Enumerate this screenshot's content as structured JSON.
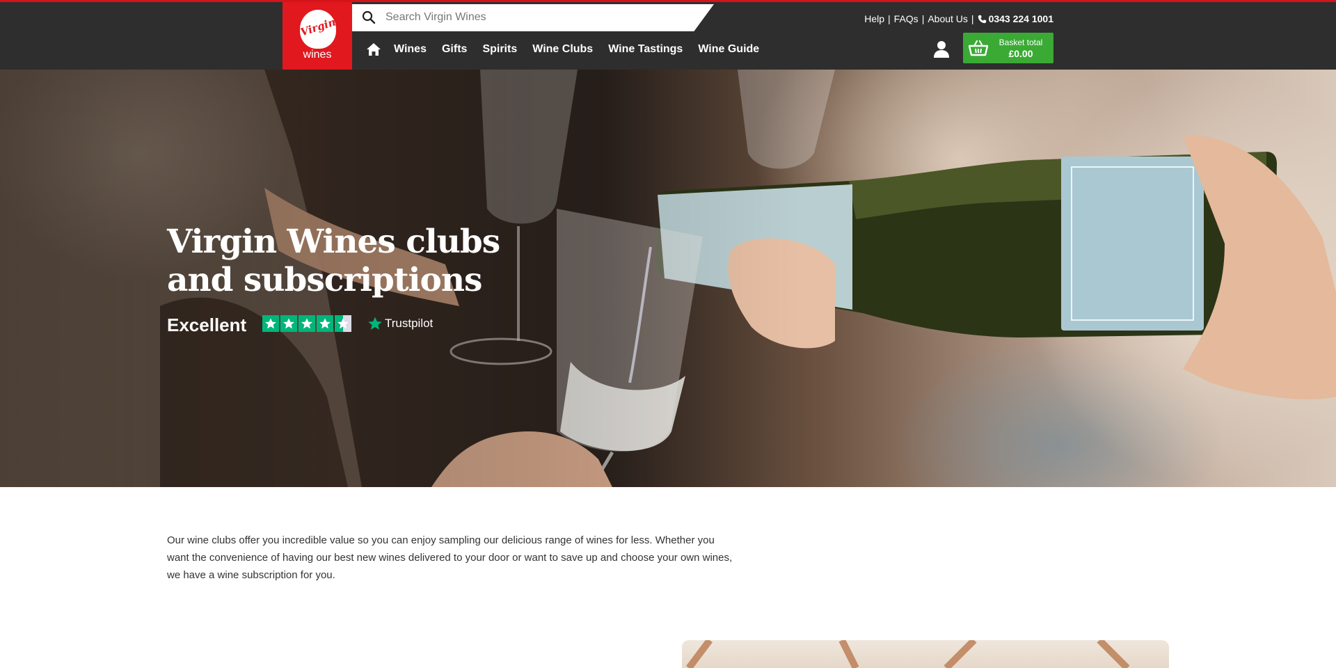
{
  "brand": {
    "logo_script": "Virgin",
    "logo_word": "wines"
  },
  "search": {
    "placeholder": "Search Virgin Wines"
  },
  "utility_links": {
    "help": "Help",
    "faqs": "FAQs",
    "about": "About Us",
    "phone": "0343 224 1001",
    "separator": "|"
  },
  "nav": {
    "items": [
      "Wines",
      "Gifts",
      "Spirits",
      "Wine Clubs",
      "Wine Tastings",
      "Wine Guide"
    ]
  },
  "basket": {
    "label": "Basket total",
    "total": "£0.00"
  },
  "hero": {
    "title_line1": "Virgin Wines clubs",
    "title_line2": "and subscriptions",
    "trustpilot_rating_word": "Excellent",
    "trustpilot_brand": "Trustpilot",
    "trustpilot_stars": 4.5
  },
  "intro": {
    "text": "Our wine clubs offer you incredible value so you can enjoy sampling our delicious range of wines for less. Whether you want the convenience of having our best new wines delivered to your door or want to save up and choose your own wines, we have a wine subscription for you."
  },
  "colors": {
    "brand_red": "#e1181e",
    "header_bg": "#2e2e2e",
    "basket_green": "#3aaa35",
    "trustpilot_green": "#00b67a"
  },
  "icons": [
    "search-icon",
    "home-icon",
    "phone-icon",
    "user-icon",
    "basket-icon",
    "star-icon",
    "trustpilot-star-icon"
  ]
}
